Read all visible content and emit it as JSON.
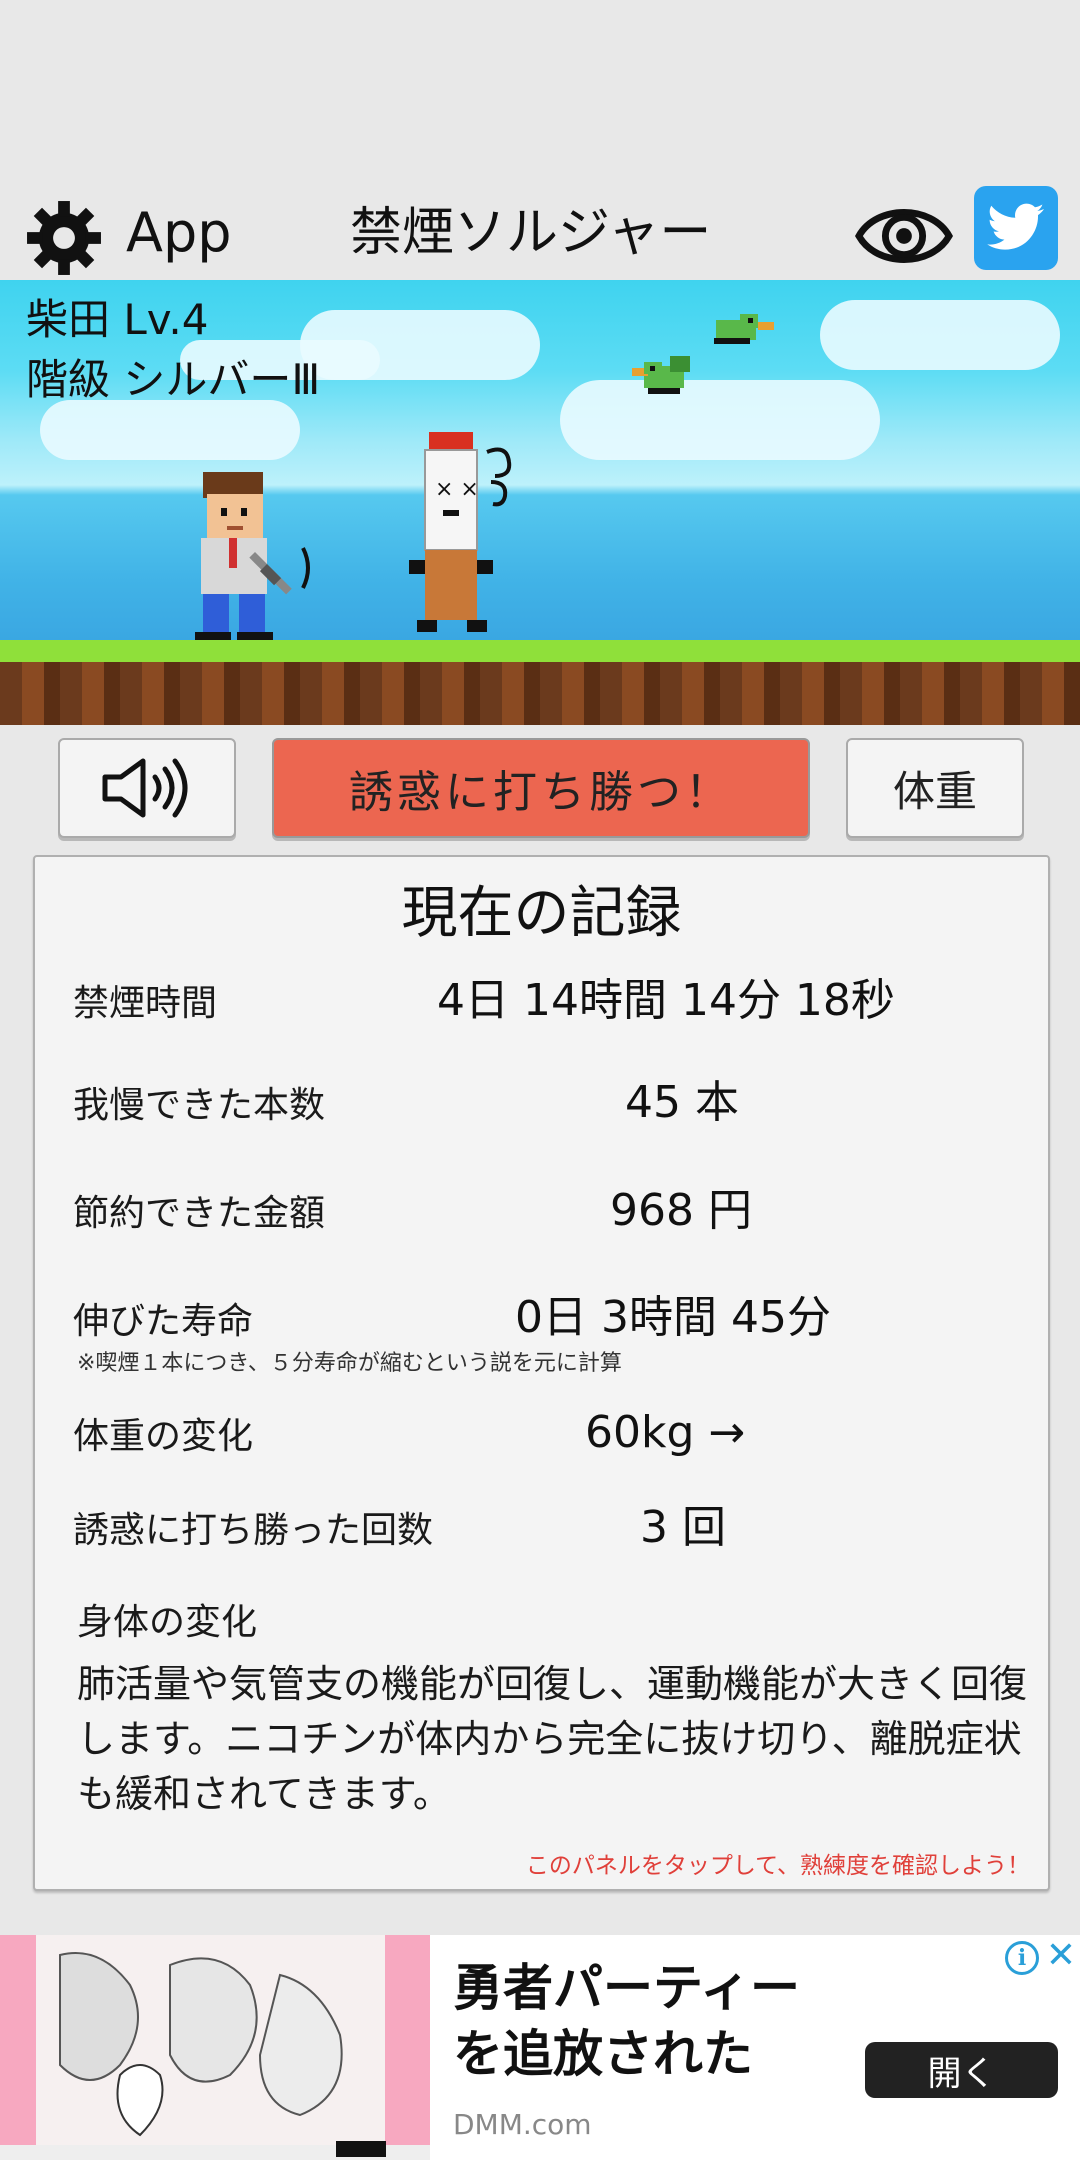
{
  "header": {
    "app_label": "App",
    "title": "禁煙ソルジャー",
    "icons": [
      "gear-icon",
      "eye-icon",
      "twitter-icon"
    ]
  },
  "scene": {
    "name_level": "柴田 Lv.4",
    "rank": "階級 シルバーⅢ"
  },
  "actions": {
    "sound_icon": "speaker-icon",
    "win_label": "誘惑に打ち勝つ！",
    "weight_label": "体重",
    "win_color": "#ec6650"
  },
  "record": {
    "title": "現在の記録",
    "rows": [
      {
        "label": "禁煙時間",
        "value": "4日 14時間 14分 18秒"
      },
      {
        "label": "我慢できた本数",
        "value": "45 本"
      },
      {
        "label": "節約できた金額",
        "value": "968 円"
      },
      {
        "label": "伸びた寿命",
        "value": "0日 3時間 45分"
      },
      {
        "label": "体重の変化",
        "value": "60kg →"
      },
      {
        "label": "誘惑に打ち勝った回数",
        "value": "3 回"
      }
    ],
    "lifespan_note": "※喫煙１本につき、５分寿命が縮むという説を元に計算",
    "body_title": "身体の変化",
    "body_text": "肺活量や気管支の機能が回復し、運動機能が大きく回復します。ニコチンが体内から完全に抜け切り、離脱症状も緩和されてきます。",
    "hint": "このパネルをタップして、熟練度を確認しよう！",
    "hint_color": "#e0403a"
  },
  "ad": {
    "title_line1": "勇者パーティー",
    "title_line2": "を追放された",
    "source": "DMM.com",
    "open_label": "開く",
    "info_icon": "info-icon",
    "close_icon": "close-icon"
  }
}
